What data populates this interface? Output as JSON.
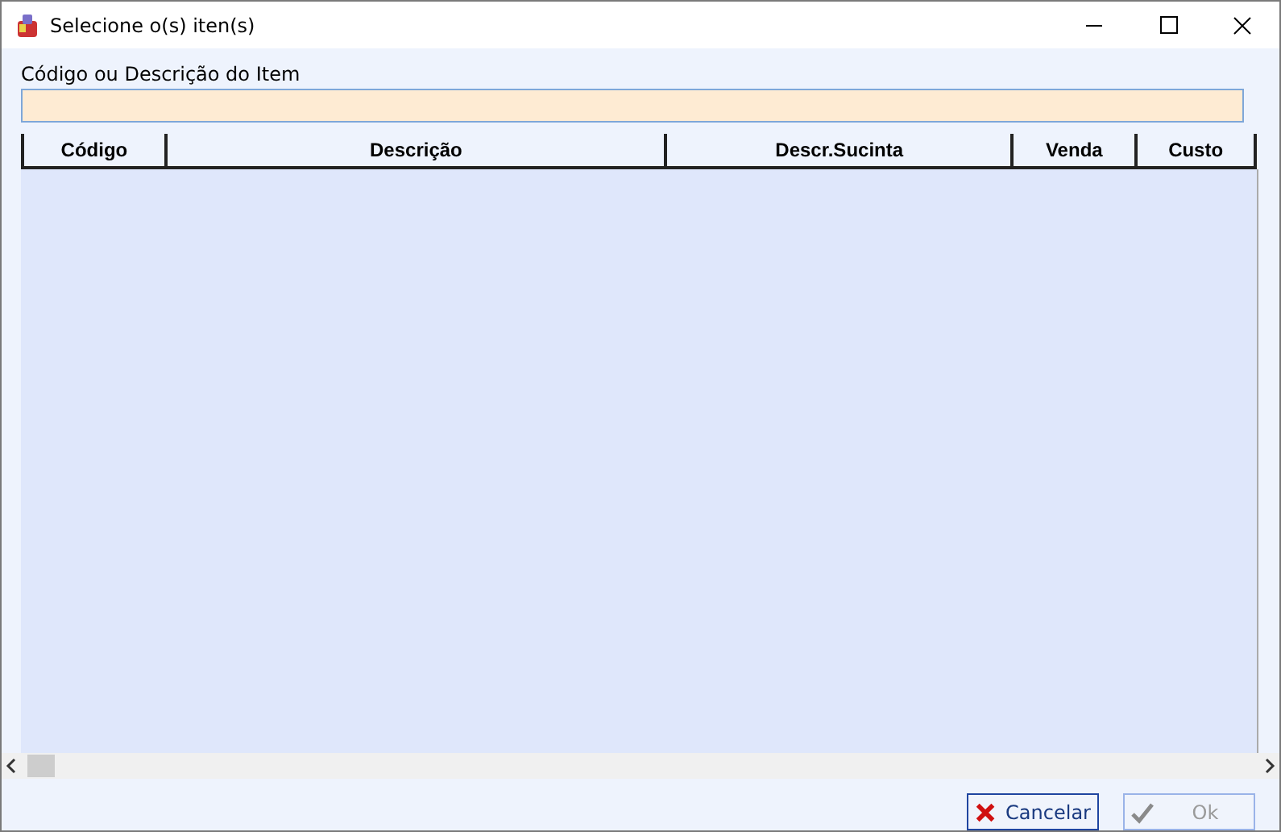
{
  "window": {
    "title": "Selecione o(s) iten(s)"
  },
  "search": {
    "label": "Código ou Descrição do Item"
  },
  "table": {
    "columns": [
      {
        "label": "Código"
      },
      {
        "label": "Descrição"
      },
      {
        "label": "Descr.Sucinta"
      },
      {
        "label": "Venda"
      },
      {
        "label": "Custo"
      }
    ]
  },
  "buttons": [
    {
      "label": "Cancelar",
      "kind": "cancel",
      "disabled": false
    },
    {
      "label": "Ok",
      "kind": "ok",
      "disabled": true
    }
  ]
}
